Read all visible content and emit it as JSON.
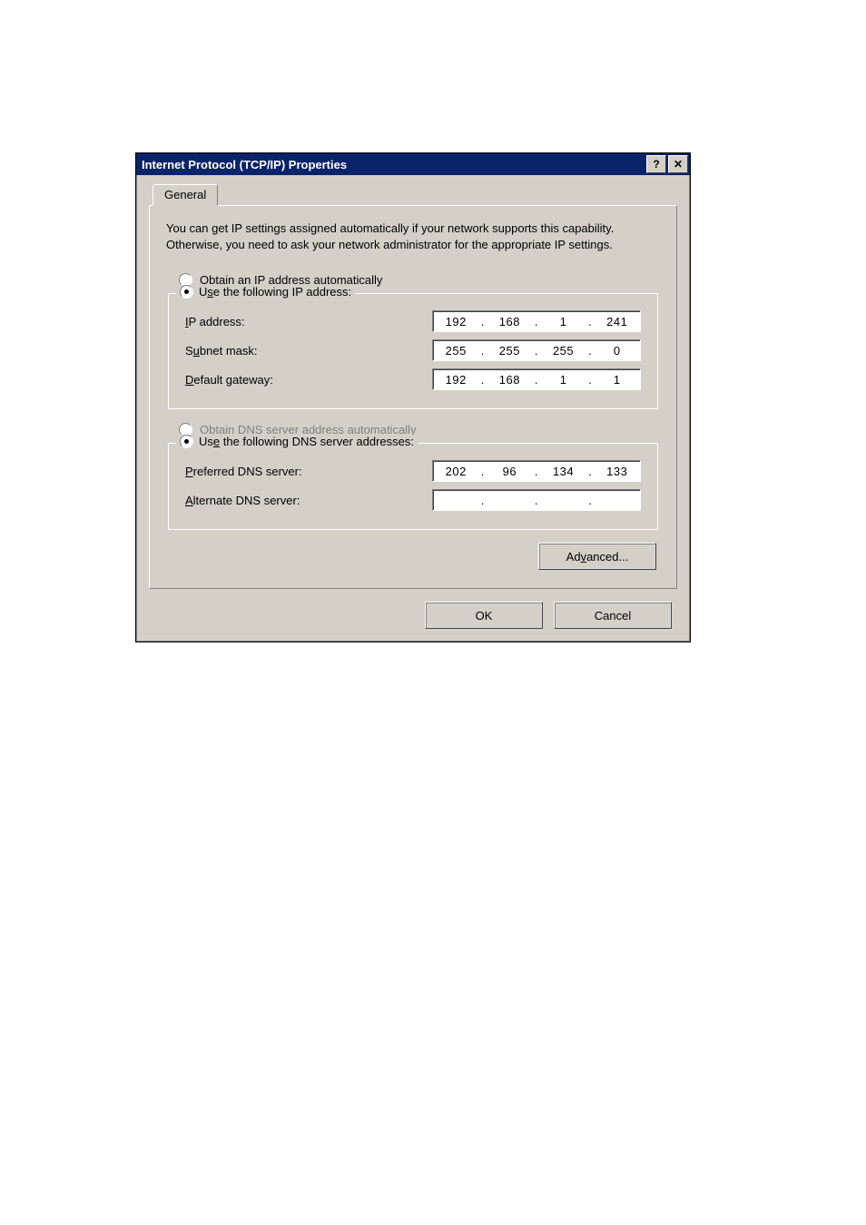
{
  "title": "Internet Protocol (TCP/IP) Properties",
  "titlebar_help_glyph": "?",
  "titlebar_close_glyph": "✕",
  "tab": {
    "general": "General"
  },
  "description": "You can get IP settings assigned automatically if your network supports this capability. Otherwise, you need to ask your network administrator for the appropriate IP settings.",
  "ip_section": {
    "obtain_auto_u": "O",
    "obtain_auto_rest": "btain an IP address automatically",
    "use_following_pre": "U",
    "use_following_u": "s",
    "use_following_post": "e the following IP address:",
    "ip_label_u": "I",
    "ip_label_rest": "P address:",
    "ip_value": {
      "o1": "192",
      "o2": "168",
      "o3": "1",
      "o4": "241"
    },
    "subnet_label_pre": "S",
    "subnet_label_u": "u",
    "subnet_label_post": "bnet mask:",
    "subnet_value": {
      "o1": "255",
      "o2": "255",
      "o3": "255",
      "o4": "0"
    },
    "gateway_label_u": "D",
    "gateway_label_rest": "efault gateway:",
    "gateway_value": {
      "o1": "192",
      "o2": "168",
      "o3": "1",
      "o4": "1"
    }
  },
  "dns_section": {
    "obtain_auto_pre": "O",
    "obtain_auto_u": "b",
    "obtain_auto_post": "tain DNS server address automatically",
    "use_following_pre": "Us",
    "use_following_u": "e",
    "use_following_post": " the following DNS server addresses:",
    "preferred_label_u": "P",
    "preferred_label_rest": "referred DNS server:",
    "preferred_value": {
      "o1": "202",
      "o2": "96",
      "o3": "134",
      "o4": "133"
    },
    "alternate_label_u": "A",
    "alternate_label_rest": "lternate DNS server:",
    "alternate_value": {
      "o1": "",
      "o2": "",
      "o3": "",
      "o4": ""
    }
  },
  "buttons": {
    "advanced_pre": "Ad",
    "advanced_u": "v",
    "advanced_post": "anced...",
    "ok": "OK",
    "cancel": "Cancel"
  }
}
